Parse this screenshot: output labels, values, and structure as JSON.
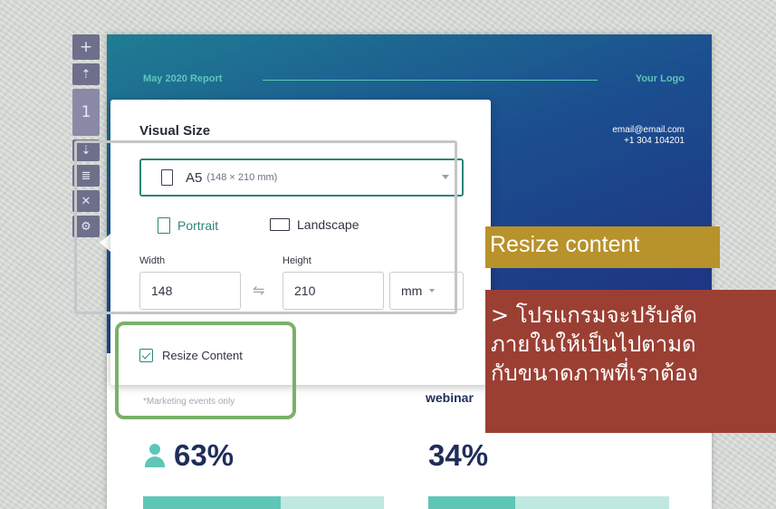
{
  "report": {
    "title": "May 2020 Report",
    "logo": "Your Logo",
    "email": "email@email.com",
    "phone": "+1 304 104201",
    "stat_left": {
      "note": "*Marketing events only",
      "value": "63%",
      "progress": 0.57
    },
    "stat_right": {
      "label": "webinar",
      "value": "34%",
      "progress": 0.36
    }
  },
  "toolbar": {
    "items": [
      {
        "name": "plus-icon",
        "glyph": "+"
      },
      {
        "name": "move-up-icon",
        "glyph": "⇡"
      },
      {
        "name": "page-number",
        "glyph": "1"
      },
      {
        "name": "move-down-icon",
        "glyph": "⇣"
      },
      {
        "name": "page-icon",
        "glyph": "≣"
      },
      {
        "name": "delete-icon",
        "glyph": "✕"
      },
      {
        "name": "gear-icon",
        "glyph": "⚙"
      }
    ]
  },
  "dialog": {
    "title": "Visual Size",
    "size_select": {
      "value": "A5",
      "dims": "(148 × 210 mm)"
    },
    "orientation": {
      "portrait": "Portrait",
      "landscape": "Landscape",
      "selected": "Portrait"
    },
    "width_label": "Width",
    "height_label": "Height",
    "width_value": "148",
    "height_value": "210",
    "unit_value": "mm",
    "resize_label": "Resize Content",
    "resize_checked": true
  },
  "annotations": {
    "resize_caption": "Resize content",
    "description_lines": [
      "> โปรแกรมจะปรับสัด",
      "ภายในให้เป็นไปตามด",
      "กับขนาดภาพที่เราต้อง"
    ]
  },
  "colors": {
    "accent": "#5ec6b6",
    "dialog_accent": "#2d8577",
    "gold": "#b8922a",
    "red": "#9b3f33",
    "green_outline": "#7ab16a"
  }
}
